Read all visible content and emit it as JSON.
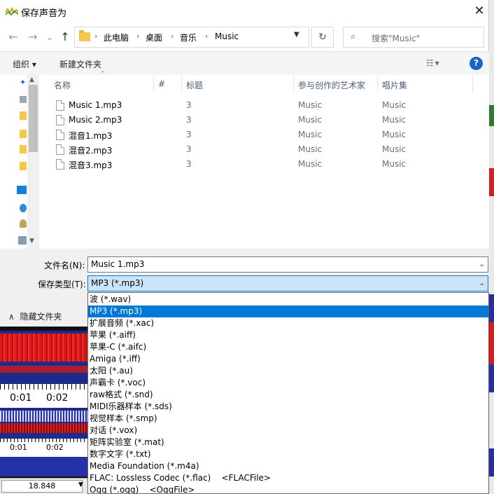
{
  "window": {
    "title": "保存声音为",
    "close_glyph": "✕"
  },
  "nav": {
    "back_glyph": "←",
    "forward_glyph": "→",
    "recent_glyph": "⌄",
    "up_glyph": "↑",
    "breadcrumb": [
      "此电脑",
      "桌面",
      "音乐",
      "Music"
    ],
    "separator_glyph": "›",
    "refresh_glyph": "↻",
    "search_placeholder": "搜索\"Music\"",
    "search_glyph": "⌕"
  },
  "toolbar": {
    "organize": "组织 ▾",
    "new_folder": "新建文件夹",
    "view_glyph": "☷ ▾",
    "help": "?"
  },
  "columns": [
    "名称",
    "#",
    "标题",
    "参与创作的艺术家",
    "唱片集"
  ],
  "files": [
    {
      "name": "Music 1.mp3",
      "num": "3",
      "artist": "Music",
      "album": "Music"
    },
    {
      "name": "Music 2.mp3",
      "num": "3",
      "artist": "Music",
      "album": "Music"
    },
    {
      "name": "混音1.mp3",
      "num": "3",
      "artist": "Music",
      "album": "Music"
    },
    {
      "name": "混音2.mp3",
      "num": "3",
      "artist": "Music",
      "album": "Music"
    },
    {
      "name": "混音3.mp3",
      "num": "3",
      "artist": "Music",
      "album": "Music"
    }
  ],
  "form": {
    "filename_label": "文件名(N):",
    "filename_value": "Music 1.mp3",
    "filetype_label": "保存类型(T):",
    "filetype_value": "MP3 (*.mp3)",
    "hide_folders": "隐藏文件夹",
    "hide_glyph": "∧"
  },
  "filetype_options": [
    "波 (*.wav)",
    "MP3 (*.mp3)",
    "扩展音频 (*.xac)",
    "苹果 (*.aiff)",
    "苹果-C (*.aifc)",
    "Amiga (*.iff)",
    "太阳 (*.au)",
    "声霸卡 (*.voc)",
    "raw格式 (*.snd)",
    "MIDI乐器样本 (*.sds)",
    "视觉样本 (*.smp)",
    "对话 (*.vox)",
    "矩阵实验室 (*.mat)",
    "数字文字 (*.txt)",
    "Media Foundation (*.m4a)",
    "FLAC: Lossless Codec (*.flac)    <FLACFile>",
    "Ogg (*.ogg)    <OggFile>"
  ],
  "selected_option_index": 1,
  "background_editor": {
    "ruler_top": [
      "0:01",
      "0:02"
    ],
    "ruler_bottom": [
      "0:01",
      "0:02"
    ],
    "zoom_value": "18.848",
    "colors": {
      "wave_red": "#e01818",
      "wave_blue": "#1d2b8a",
      "accent": "#0078d7"
    }
  }
}
